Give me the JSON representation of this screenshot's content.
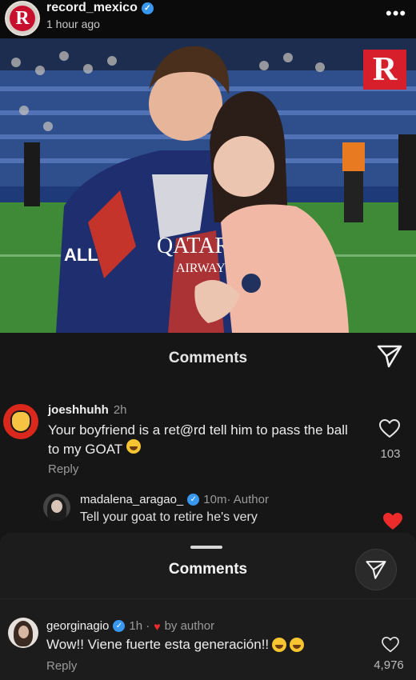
{
  "post": {
    "username": "record_mexico",
    "timestamp": "1 hour ago",
    "logo_letter": "R"
  },
  "photo": {
    "shirt_text_1": "QATAR",
    "shirt_text_2": "AIRWAYS",
    "sponsor_text": "ALL"
  },
  "sheet1": {
    "title": "Comments",
    "comments": [
      {
        "username": "joeshhuhh",
        "age": "2h",
        "text": "Your boyfriend is a ret@rd tell him to pass the ball to my GOAT",
        "reply_label": "Reply",
        "likes": "103"
      },
      {
        "username": "madalena_aragao_",
        "meta": "10m· Author",
        "text": "Tell your goat to retire he's very"
      }
    ]
  },
  "sheet2": {
    "title": "Comments",
    "comment": {
      "username": "georginagio",
      "age": "1h ·",
      "by_label": "by author",
      "text": "Wow!! Viene fuerte esta generación!!",
      "reply_label": "Reply",
      "likes": "4,976"
    }
  },
  "colors": {
    "accent_red": "#d61f2b",
    "verified_blue": "#3897f0",
    "liked_heart": "#ed2b2b"
  }
}
